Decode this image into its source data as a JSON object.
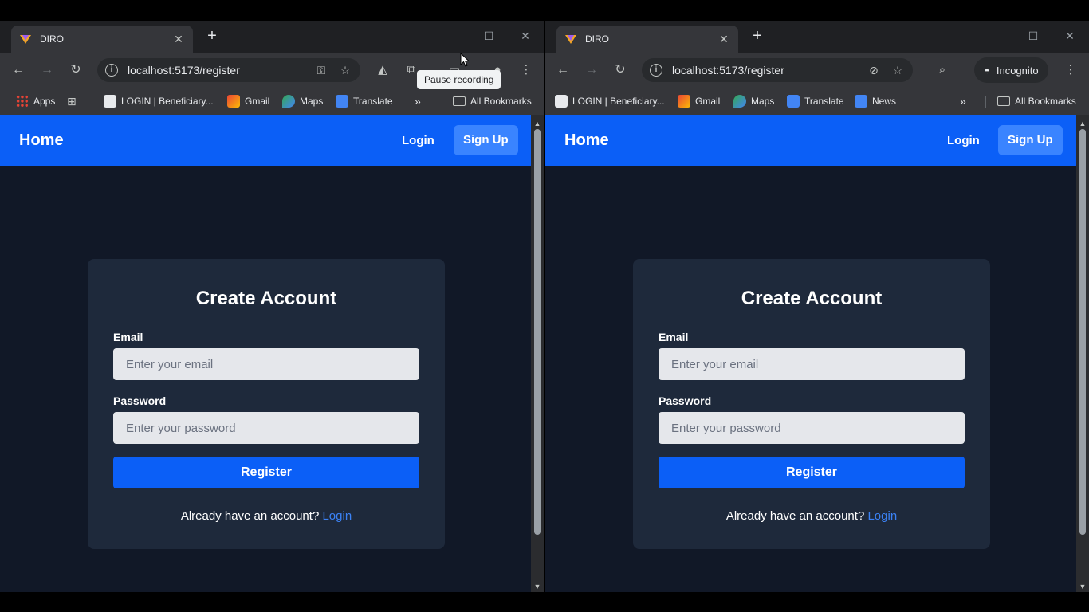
{
  "colors": {
    "accent": "#0b5ff7",
    "page_bg": "#111827",
    "card_bg": "#1e293b",
    "link": "#3b82f6"
  },
  "left_window": {
    "tab_title": "DIRO",
    "url": "localhost:5173/register",
    "tooltip": "Pause recording",
    "bookmarks": {
      "apps": "Apps",
      "items": [
        "LOGIN | Beneficiary...",
        "Gmail",
        "Maps",
        "Translate"
      ],
      "all_bookmarks": "All Bookmarks"
    }
  },
  "right_window": {
    "tab_title": "DIRO",
    "url": "localhost:5173/register",
    "incognito_label": "Incognito",
    "bookmarks": {
      "items": [
        "LOGIN | Beneficiary...",
        "Gmail",
        "Maps",
        "Translate",
        "News"
      ],
      "all_bookmarks": "All Bookmarks"
    }
  },
  "app": {
    "nav": {
      "home": "Home",
      "login": "Login",
      "signup": "Sign Up"
    },
    "form": {
      "title": "Create Account",
      "email_label": "Email",
      "email_placeholder": "Enter your email",
      "password_label": "Password",
      "password_placeholder": "Enter your password",
      "submit": "Register",
      "footer_text": "Already have an account?",
      "footer_link": "Login"
    }
  }
}
